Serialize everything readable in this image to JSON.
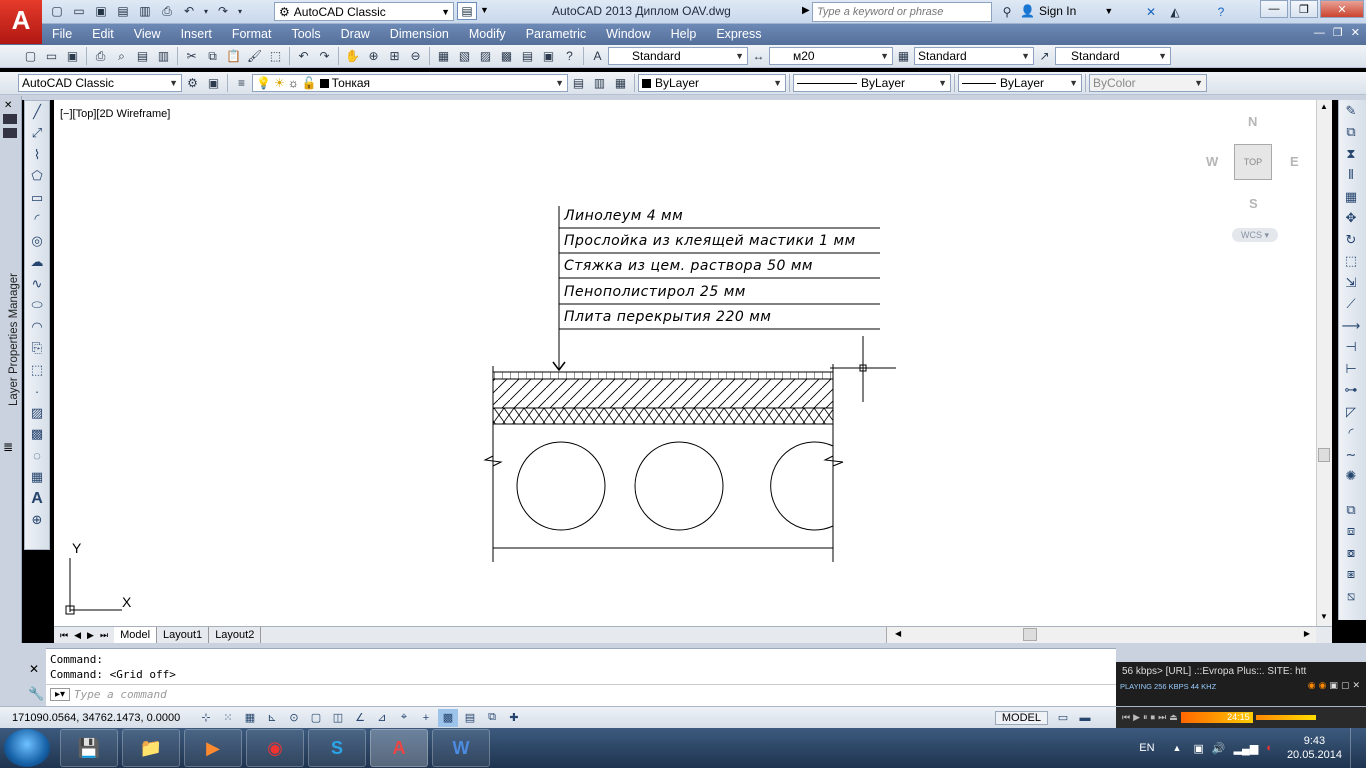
{
  "window": {
    "app_logo": "A",
    "title": "AutoCAD 2013   Диплом OAV.dwg",
    "workspace": "AutoCAD Classic",
    "search_placeholder": "Type a keyword or phrase",
    "sign_in": "Sign In"
  },
  "menu": [
    "File",
    "Edit",
    "View",
    "Insert",
    "Format",
    "Tools",
    "Draw",
    "Dimension",
    "Modify",
    "Parametric",
    "Window",
    "Help",
    "Express"
  ],
  "styles_toolbar": {
    "text_style": "Standard",
    "dim_style": "м20",
    "table_style": "Standard",
    "mleader_style": "Standard"
  },
  "layers_toolbar": {
    "workspace": "AutoCAD Classic",
    "layer": "Тонкая",
    "color": "ByLayer",
    "linetype": "ByLayer",
    "lineweight": "ByLayer",
    "plotstyle": "ByColor"
  },
  "palette_label": "Layer Properties Manager",
  "viewport": {
    "label": "[−][Top][2D Wireframe]",
    "viewcube": {
      "n": "N",
      "s": "S",
      "e": "E",
      "w": "W",
      "face": "TOP",
      "ucs": "WCS"
    },
    "ucs_x": "X",
    "ucs_y": "Y"
  },
  "drawing": {
    "layers": [
      "Линолеум 4 мм",
      "Прослойка из клеящей мастики 1 мм",
      "Стяжка из цем. раствора 50 мм",
      "Пенополистирол 25 мм",
      "Плита перекрытия 220 мм"
    ]
  },
  "tabs": [
    "Model",
    "Layout1",
    "Layout2"
  ],
  "command": {
    "lines": [
      "Command:",
      "Command:  <Grid off>"
    ],
    "placeholder": "Type a command"
  },
  "media": {
    "line1": "56 kbps>  [URL] .::Evropa Plus::. SITE: htt",
    "line2": "PLAYING   256 KBPS   44 KHZ",
    "time": "24:15"
  },
  "status": {
    "coords": "171090.0564, 34762.1473, 0.0000",
    "model": "MODEL"
  },
  "taskbar": {
    "lang": "EN",
    "time": "9:43",
    "date": "20.05.2014"
  }
}
